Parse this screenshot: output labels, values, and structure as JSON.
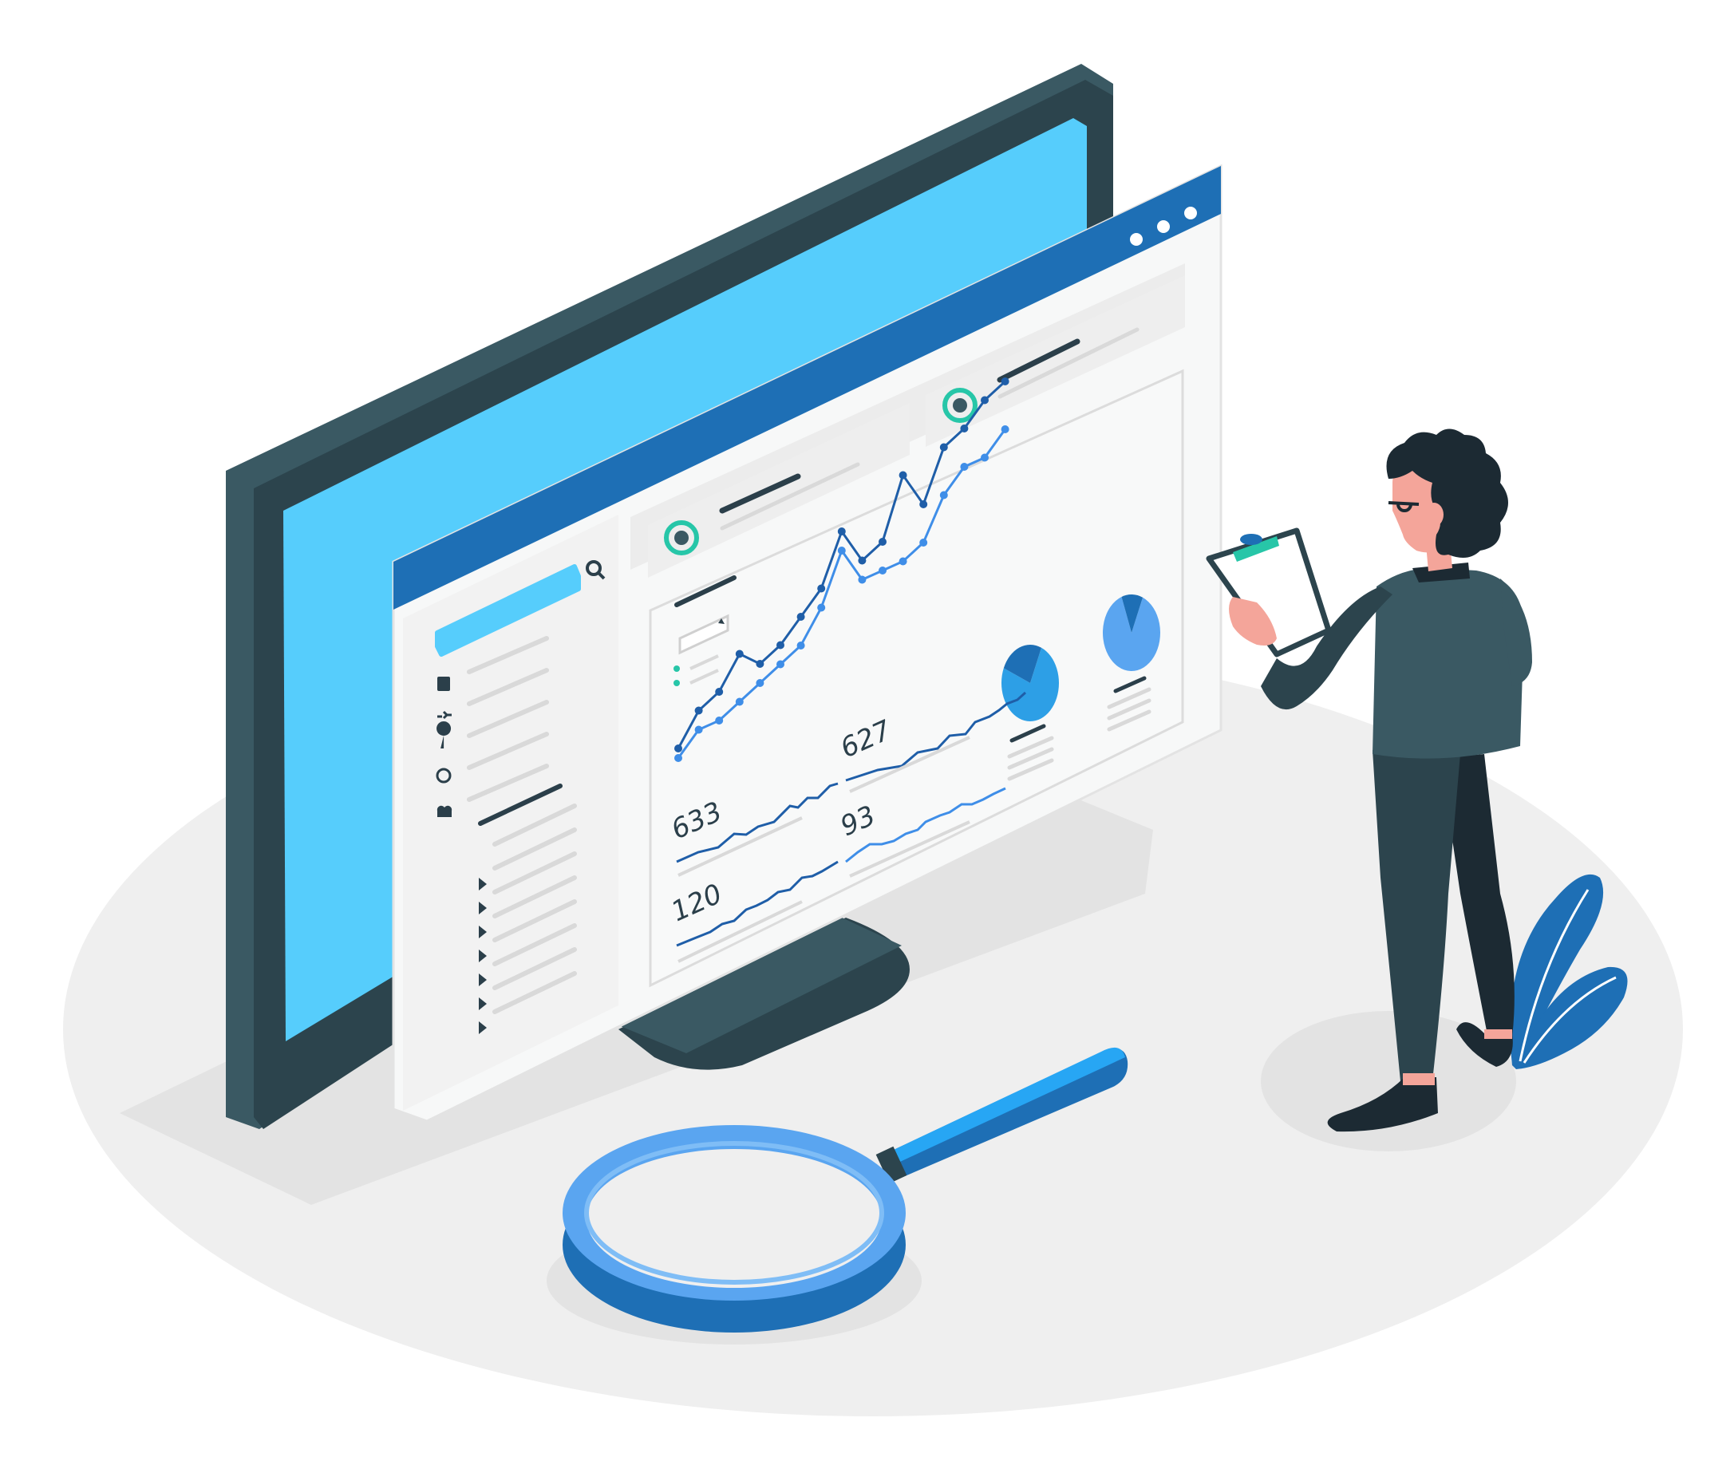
{
  "colors": {
    "floor": "#efefef",
    "floor_shadow": "#e3e3e3",
    "monitor_frame_dark": "#2c444d",
    "monitor_frame": "#3a5963",
    "monitor_screen": "#56cdfc",
    "browser_bar": "#1e6fb5",
    "browser_body": "#f7f8f8",
    "panel_gray": "#e8e8e8",
    "line_dark": "#1f5ea8",
    "line_light": "#3f8ee8",
    "accent_teal": "#27c6a8",
    "accent_blue": "#2d9fe6",
    "text_dark": "#2b3f4a",
    "skin": "#f4a59a",
    "hair": "#1c2a33",
    "plant": "#1e6fb5"
  },
  "browser": {
    "window_dots": [
      "dot",
      "dot",
      "dot"
    ],
    "search_icon": "search-icon"
  },
  "sidebar": {
    "icons": [
      "chart-icon",
      "refresh-icon",
      "lightbulb-icon",
      "chat-icon",
      "users-icon"
    ]
  },
  "metrics": [
    {
      "id": "m627",
      "value": "627"
    },
    {
      "id": "m633",
      "value": "633"
    },
    {
      "id": "m93",
      "value": "93"
    },
    {
      "id": "m120",
      "value": "120"
    }
  ],
  "chart_data": [
    {
      "type": "line",
      "series": [
        {
          "values": [
            2,
            5,
            6,
            9,
            7,
            8,
            10,
            12,
            17,
            13,
            14,
            20,
            16,
            21,
            22,
            24,
            25
          ]
        },
        {
          "values": [
            1,
            3,
            3,
            4,
            5,
            6,
            7,
            10,
            15,
            11,
            11,
            11,
            12,
            16,
            18,
            18,
            20
          ]
        }
      ]
    },
    {
      "type": "pie",
      "values": [
        75,
        25
      ]
    },
    {
      "type": "pie",
      "values": [
        88,
        12
      ]
    }
  ]
}
